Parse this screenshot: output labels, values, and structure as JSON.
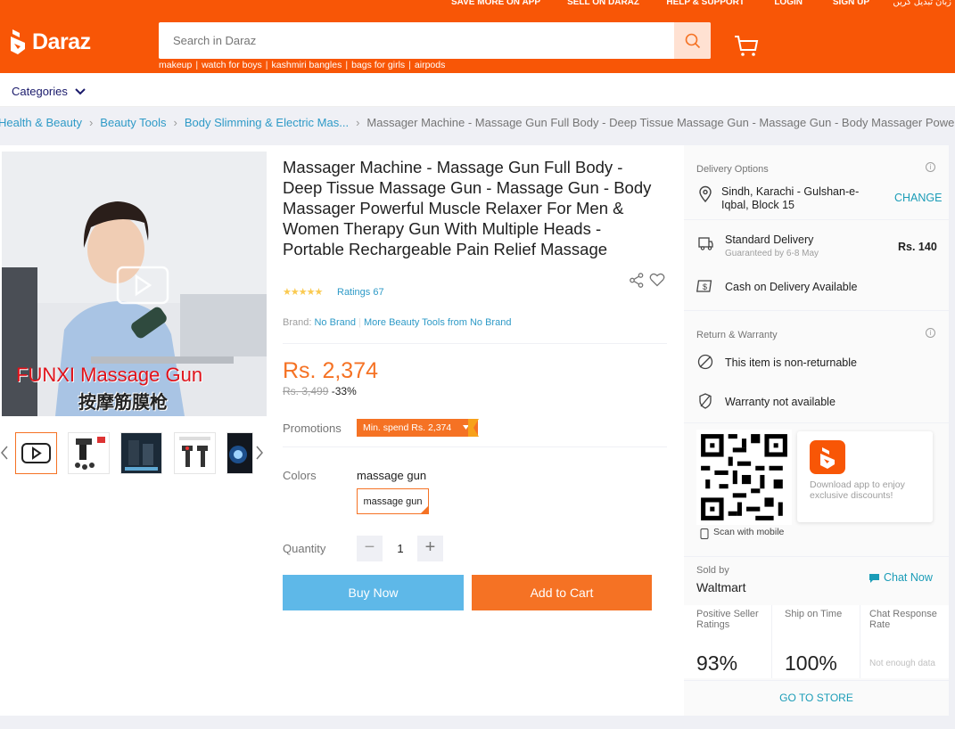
{
  "toplinks": [
    "SAVE MORE ON APP",
    "SELL ON DARAZ",
    "HELP & SUPPORT",
    "LOGIN",
    "SIGN UP",
    "زبان تبدیل کریں"
  ],
  "logo_text": "Daraz",
  "search": {
    "placeholder": "Search in Daraz"
  },
  "suggestions": [
    "makeup",
    "watch for boys",
    "kashmiri bangles",
    "bags for girls",
    "airpods"
  ],
  "categories_label": "Categories",
  "breadcrumb": [
    "Health & Beauty",
    "Beauty Tools",
    "Body Slimming & Electric Mas..."
  ],
  "breadcrumb_current": "Massager Machine - Massage Gun Full Body - Deep Tissue Massage Gun - Massage Gun - Body Massager Powerful",
  "image_overlay": {
    "text_en": "FUNXI Massage Gun",
    "text_cn": "按摩筋膜枪"
  },
  "product": {
    "title": "Massager Machine - Massage Gun Full Body - Deep Tissue Massage Gun - Massage Gun - Body Massager Powerful Muscle Relaxer For Men & Women Therapy Gun With Multiple Heads - Portable Rechargeable Pain Relief Massage",
    "rating_stars": 5,
    "ratings_label": "Ratings 67",
    "brand_label": "Brand:",
    "brand_value": "No Brand",
    "brand_more": "More Beauty Tools from No Brand",
    "price": "Rs. 2,374",
    "old_price": "Rs. 3,499",
    "discount": "-33%",
    "promotions_label": "Promotions",
    "promo_badge": "Min. spend Rs. 2,374",
    "colors_label": "Colors",
    "color_selected": "massage gun",
    "color_option": "massage gun",
    "quantity_label": "Quantity",
    "quantity": "1",
    "qty_minus": "−",
    "qty_plus": "+",
    "buy_now": "Buy Now",
    "add_to_cart": "Add to Cart"
  },
  "delivery": {
    "title": "Delivery Options",
    "location": "Sindh, Karachi - Gulshan-e-Iqbal, Block 15",
    "change": "CHANGE",
    "standard": "Standard Delivery",
    "guaranteed": "Guaranteed by 6-8 May",
    "fee": "Rs. 140",
    "cod": "Cash on Delivery Available"
  },
  "warranty": {
    "title": "Return & Warranty",
    "return": "This item is non-returnable",
    "warranty": "Warranty not available"
  },
  "app": {
    "text": "Download app to enjoy exclusive discounts!",
    "scan": "Scan with mobile"
  },
  "seller": {
    "sold_by": "Sold by",
    "name": "Waltmart",
    "chat": "Chat Now",
    "stats": [
      {
        "label": "Positive Seller Ratings",
        "value": "93%"
      },
      {
        "label": "Ship on Time",
        "value": "100%"
      },
      {
        "label": "Chat Response Rate",
        "value": "Not enough data"
      }
    ],
    "go_to_store": "GO TO STORE"
  },
  "colors": {
    "brand": "#f85606",
    "price": "#f57224",
    "link": "#2e9ac7",
    "buy": "#5eb8e8",
    "cart": "#f57224"
  }
}
